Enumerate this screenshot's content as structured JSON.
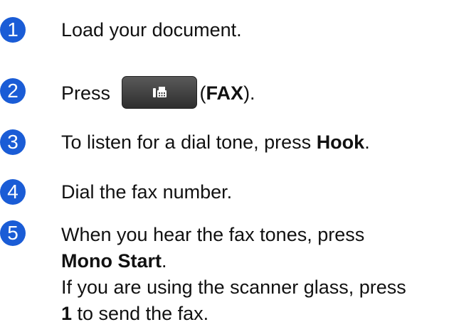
{
  "colors": {
    "step_badge": "#1a5cd6",
    "text": "#111111",
    "fax_key": "#3d3d3d"
  },
  "steps": [
    {
      "number": "1",
      "text": "Load your document."
    },
    {
      "number": "2",
      "pre": "Press",
      "open_paren": "(",
      "bold": "FAX",
      "close": ").",
      "icon": "fax-icon"
    },
    {
      "number": "3",
      "pre": "To listen for a dial tone, press ",
      "bold": "Hook",
      "post": "."
    },
    {
      "number": "4",
      "text": "Dial the fax number."
    },
    {
      "number": "5",
      "line1": "When you hear the fax tones, press",
      "line2_bold": "Mono Start",
      "line2_post": ".",
      "line3": "If you are using the scanner glass, press",
      "line4_bold": "1",
      "line4_post": " to send the fax."
    }
  ]
}
